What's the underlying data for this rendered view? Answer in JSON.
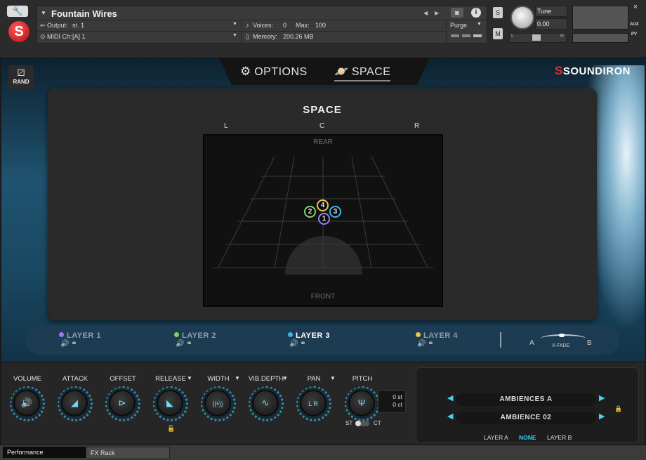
{
  "header": {
    "wrench_icon": "wrench-icon",
    "instrument_name": "Fountain Wires",
    "output_label": "Output:",
    "output_value": "st. 1",
    "midi_label": "MIDI Ch:",
    "midi_value": "[A]  1",
    "voices_label": "Voices:",
    "voices_value": "0",
    "max_label": "Max:",
    "max_value": "100",
    "memory_label": "Memory:",
    "memory_value": "200.26 MB",
    "purge_label": "Purge",
    "solo_label": "S",
    "mute_label": "M",
    "tune_label": "Tune",
    "tune_value": "0.00",
    "close_label": "×",
    "aux_label": "AUX",
    "pv_label": "PV",
    "pan_l": "L",
    "pan_r": "R"
  },
  "nav": {
    "rand_label": "RAND",
    "tab_options": "OPTIONS",
    "tab_space": "SPACE",
    "brand": "SOUNDIRON",
    "active_tab": "space"
  },
  "space": {
    "title": "SPACE",
    "left": "L",
    "center": "C",
    "right": "R",
    "rear": "REAR",
    "front": "FRONT",
    "markers": [
      {
        "label": "1",
        "color": "#9a7df0"
      },
      {
        "label": "2",
        "color": "#7fd46a"
      },
      {
        "label": "3",
        "color": "#3fb2e6"
      },
      {
        "label": "4",
        "color": "#e7c94b"
      }
    ]
  },
  "layers": {
    "items": [
      {
        "label": "LAYER 1",
        "color": "#9a7df0",
        "active": false
      },
      {
        "label": "LAYER 2",
        "color": "#7fd46a",
        "active": false
      },
      {
        "label": "LAYER 3",
        "color": "#3fb2e6",
        "active": true
      },
      {
        "label": "LAYER 4",
        "color": "#e7c94b",
        "active": false
      }
    ],
    "xfade_a": "A",
    "xfade_label": "X-FADE",
    "xfade_b": "B"
  },
  "controls": {
    "knobs": [
      {
        "label": "VOLUME",
        "icon": "speaker-icon",
        "glyph": "🔊",
        "dropdown": false
      },
      {
        "label": "ATTACK",
        "icon": "attack-ramp-icon",
        "glyph": "◢",
        "dropdown": false
      },
      {
        "label": "OFFSET",
        "icon": "offset-play-icon",
        "glyph": "⊳",
        "dropdown": false
      },
      {
        "label": "RELEASE",
        "icon": "release-ramp-icon",
        "glyph": "◣",
        "dropdown": true
      },
      {
        "label": "WIDTH",
        "icon": "width-waves-icon",
        "glyph": "((•))",
        "dropdown": true
      },
      {
        "label": "VIB.DEPTH",
        "icon": "vibrato-icon",
        "glyph": "∿",
        "dropdown": true
      },
      {
        "label": "PAN",
        "icon": "pan-icon",
        "glyph": "L R",
        "dropdown": true
      },
      {
        "label": "PITCH",
        "icon": "tuning-fork-icon",
        "glyph": "Ψ",
        "dropdown": false
      }
    ],
    "pitch_st": "0 st",
    "pitch_ct": "0 ct",
    "st_label": "ST",
    "ct_label": "CT"
  },
  "ambience": {
    "category": "AMBIENCES A",
    "preset": "AMBIENCE 02",
    "layer_a": "LAYER A",
    "none": "NONE",
    "layer_b": "LAYER B",
    "accent": "#35d0ee"
  },
  "footer": {
    "performance": "Performance",
    "fx_rack": "FX Rack"
  }
}
